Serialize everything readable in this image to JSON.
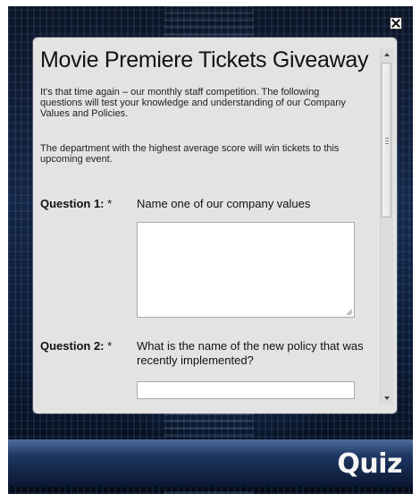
{
  "window": {
    "close_icon": "close-icon"
  },
  "panel": {
    "title": "Movie Premiere Tickets Giveaway",
    "intro": "It's that time again – our monthly staff competition. The following questions will test your knowledge and understanding of our Company Values and Policies.",
    "department_note": "The department with the highest average score will win tickets to this upcoming event."
  },
  "questions": [
    {
      "label": "Question 1:",
      "required_mark": "*",
      "text": "Name one of our company values",
      "answer": ""
    },
    {
      "label": "Question 2:",
      "required_mark": "*",
      "text": "What is the name of the new policy that was recently implemented?",
      "answer": ""
    }
  ],
  "footer": {
    "label": "Quiz"
  },
  "colors": {
    "panel_background": "#e3e3e3",
    "footer_bar": "#1e3661"
  }
}
